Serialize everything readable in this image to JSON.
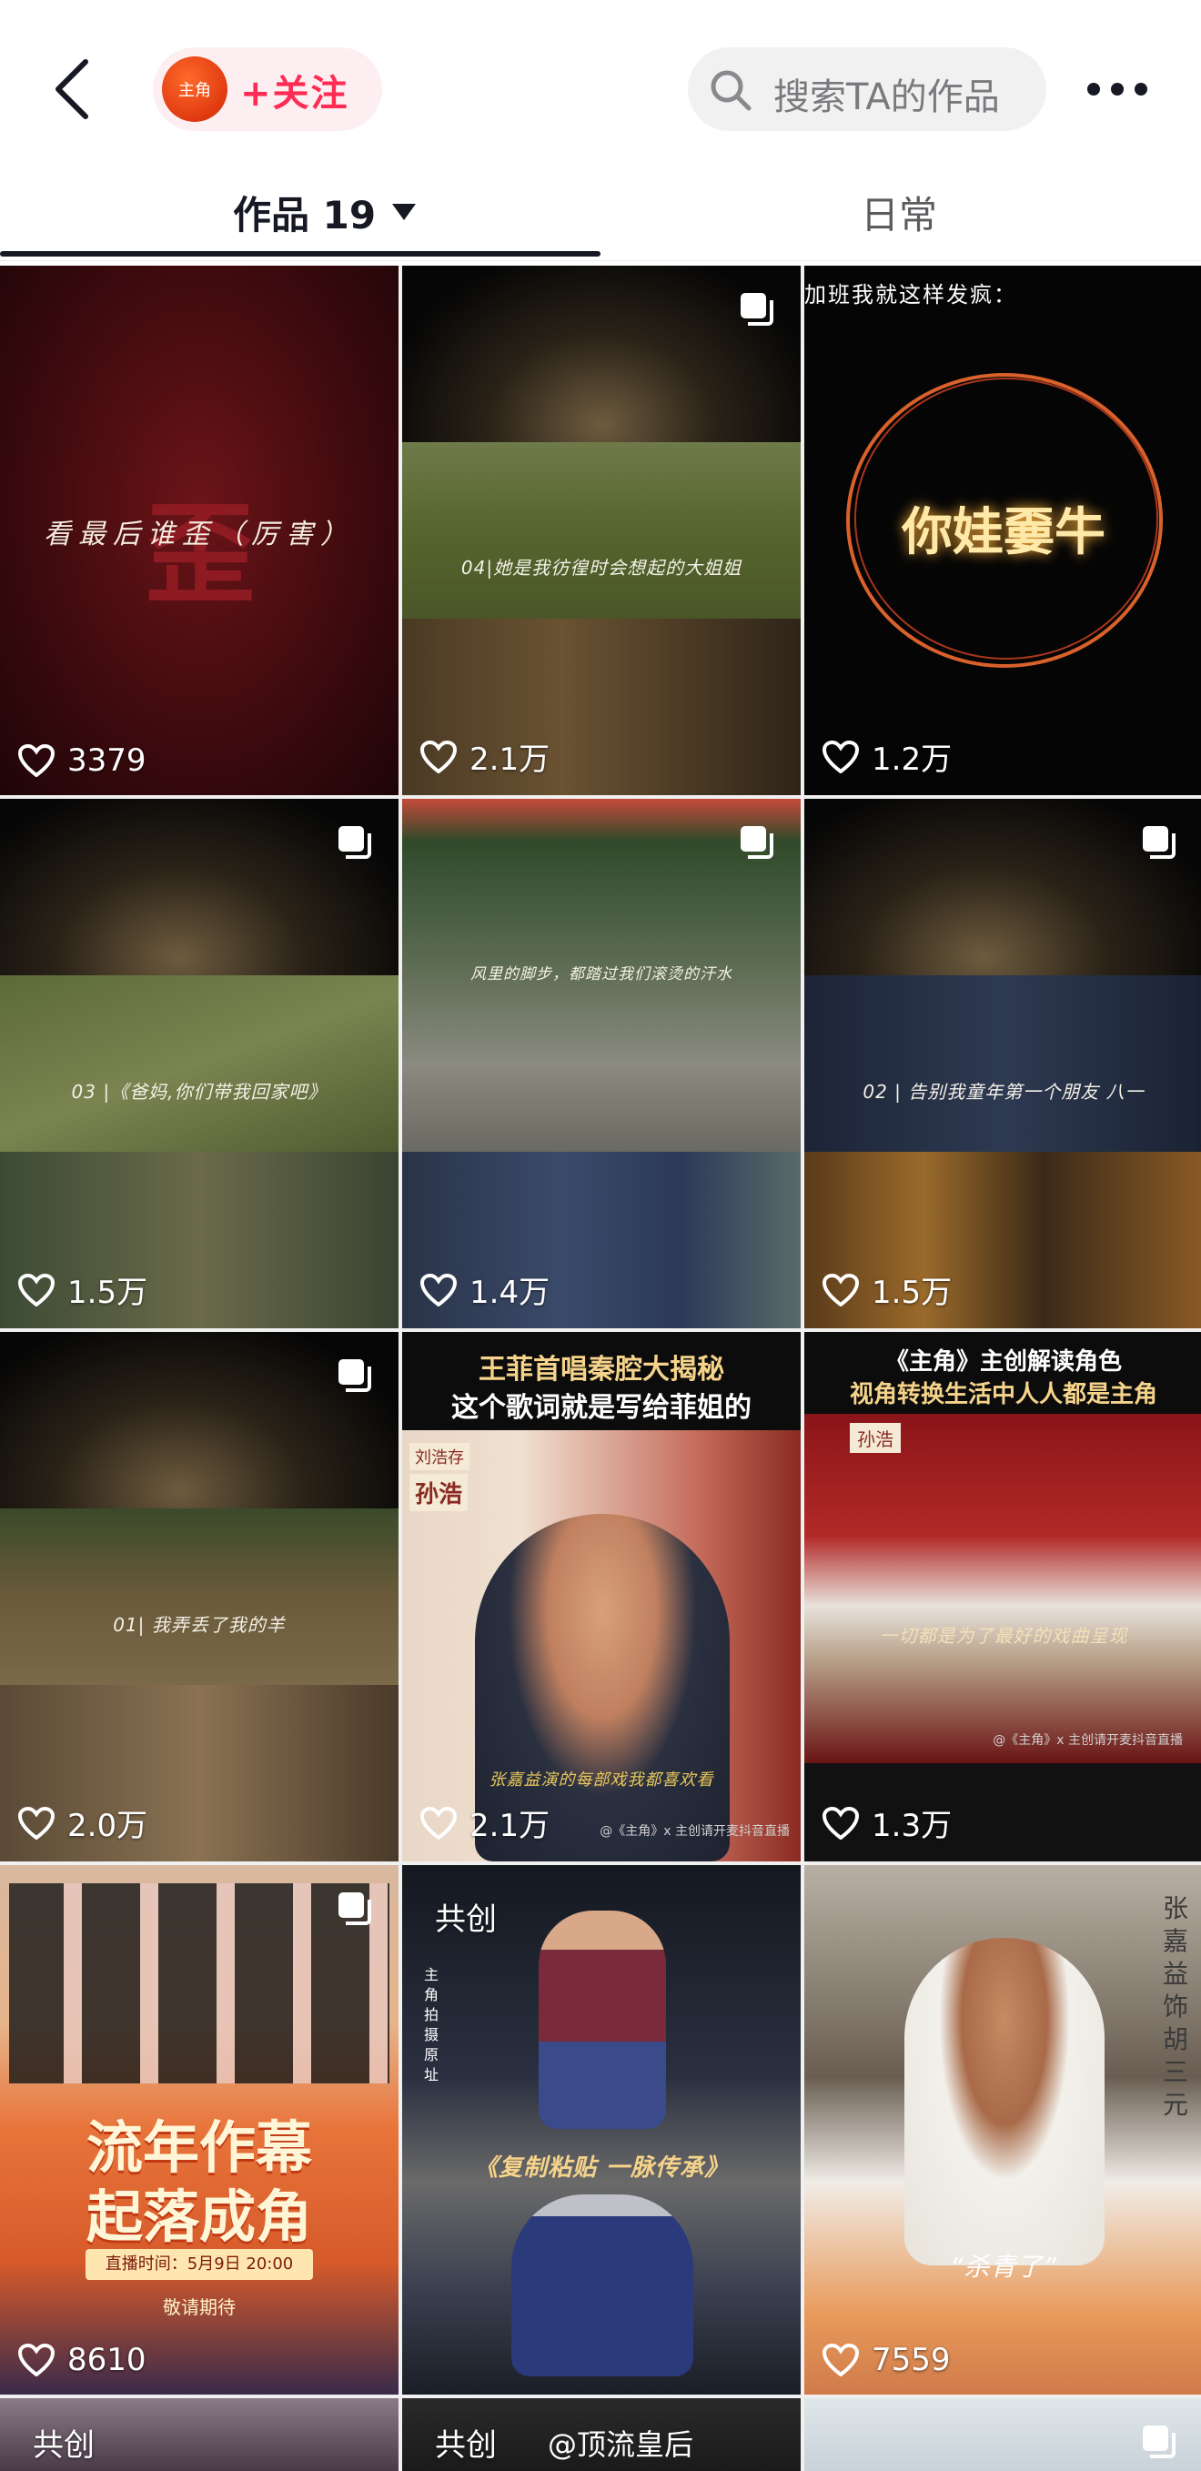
{
  "header": {
    "back_icon": "back-chevron-icon",
    "account_badge": "主角",
    "follow_label": "+关注",
    "search_placeholder": "搜索TA的作品",
    "more_icon": "more-dots-icon"
  },
  "tabs": [
    {
      "label": "作品 19",
      "active": true
    },
    {
      "label": "日常",
      "active": false
    }
  ],
  "colors": {
    "accent": "#fe2c55",
    "text": "#161823"
  },
  "videos": [
    {
      "likes": "3379",
      "caption": "看最后谁歪（厉害）",
      "glyph": "歪",
      "multi": false
    },
    {
      "likes": "2.1万",
      "caption": "04|她是我彷徨时会想起的大姐姐",
      "multi": true
    },
    {
      "likes": "1.2万",
      "caption_top": "加班我就这样发疯：",
      "caption": "你娃嫑牛",
      "multi": false
    },
    {
      "likes": "1.5万",
      "caption": "03 |《爸妈,你们带我回家吧》",
      "multi": true
    },
    {
      "likes": "1.4万",
      "caption": "风里的脚步，都踏过我们滚烫的汗水",
      "multi": true
    },
    {
      "likes": "1.5万",
      "caption": "02 | 告别我童年第一个朋友 八一",
      "multi": true
    },
    {
      "likes": "2.0万",
      "caption": "01| 我弄丢了我的羊",
      "multi": true
    },
    {
      "likes": "2.1万",
      "title_line1": "王菲首唱秦腔大揭秘",
      "title_line2": "这个歌词就是写给菲姐的",
      "side_label1": "刘浩存",
      "side_label2": "孙浩",
      "subtitle": "张嘉益演的每部戏我都喜欢看",
      "footer": "@《主角》x 主创请开麦抖音直播",
      "multi": false
    },
    {
      "likes": "1.3万",
      "title_line1": "《主角》主创解读角色",
      "title_line2": "视角转换生活中人人都是主角",
      "side_label": "孙浩",
      "subtitle": "一切都是为了最好的戏曲呈现",
      "footer": "@《主角》x 主创请开麦抖音直播",
      "multi": false
    },
    {
      "likes": "8610",
      "title_line1": "流年作幕",
      "title_line2": "起落成角",
      "banner": "直播时间：5月9日 20:00",
      "sub": "敬请期待",
      "multi": true
    },
    {
      "likes": "",
      "tag": "共创",
      "side_label": "主角 拍摄原址",
      "caption": "《复制粘贴 一脉传承》",
      "multi": false
    },
    {
      "likes": "7559",
      "side_label": "张嘉益 饰 胡三元",
      "caption": "“杀青了”",
      "multi": false
    }
  ],
  "partial_row": [
    {
      "tag": "共创"
    },
    {
      "tag": "共创",
      "extra": "@顶流皇后"
    },
    {
      "tag": ""
    }
  ]
}
